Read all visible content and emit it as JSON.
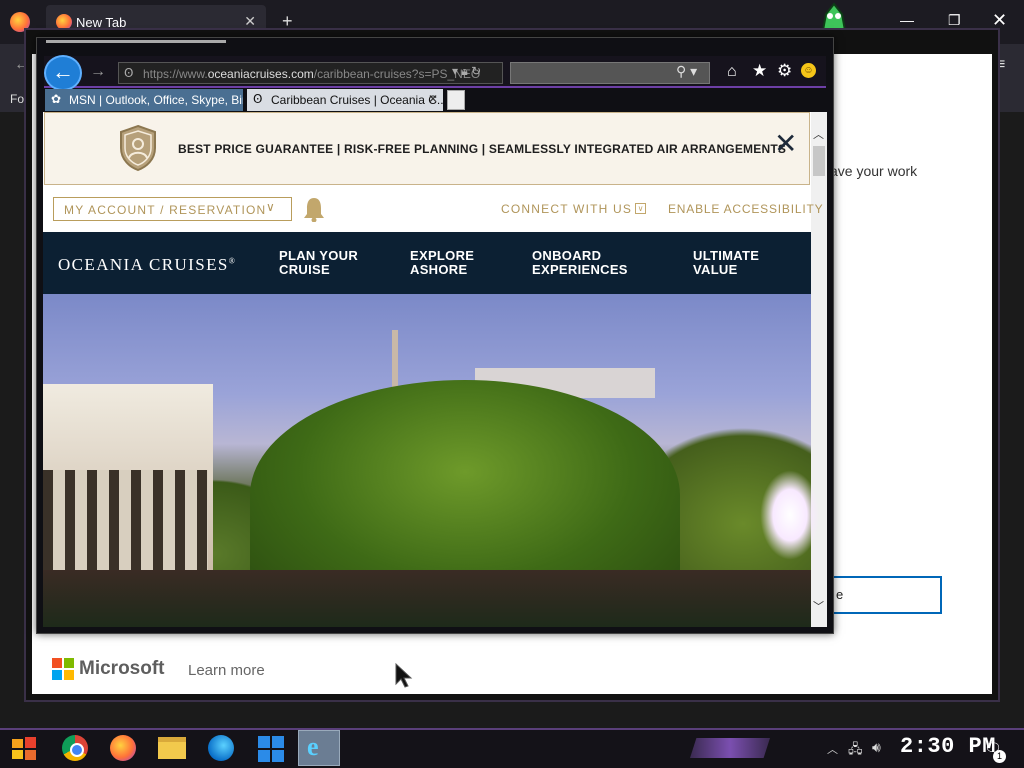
{
  "firefox": {
    "tab_title": "New Tab",
    "tab_close": "✕",
    "new_tab": "+",
    "toolbar_text": "Fo",
    "window_min": "—",
    "window_max": "❐",
    "window_close": "✕"
  },
  "dialog": {
    "partial_text": "ave your work",
    "button_partial": "e",
    "ms_brand": "Microsoft",
    "learn_more": "Learn more"
  },
  "ie": {
    "url_prefix": "https://www.",
    "url_domain": "oceaniacruises.com",
    "url_rest": "/caribbean-cruises?s=PS_NEO",
    "tabs": [
      {
        "label": "MSN | Outlook, Office, Skype, Bin...",
        "icon": "msn-icon"
      },
      {
        "label": "Caribbean Cruises | Oceania C...",
        "icon": "oceania-favicon"
      }
    ],
    "icons": [
      "back-icon",
      "forward-icon",
      "lock-icon",
      "refresh-icon",
      "search-icon",
      "home-icon",
      "favorites-star-icon",
      "gear-icon",
      "smiley-icon"
    ]
  },
  "site": {
    "promo": "BEST PRICE GUARANTEE | RISK-FREE PLANNING | SEAMLESSLY INTEGRATED AIR ARRANGEMENTS",
    "account": "MY ACCOUNT / RESERVATION",
    "connect": "CONNECT WITH US",
    "accessibility": "ENABLE ACCESSIBILITY",
    "logo": "OCEANIA CRUISES",
    "nav": [
      {
        "line1": "PLAN YOUR",
        "line2": "CRUISE"
      },
      {
        "line1": "EXPLORE",
        "line2": "ASHORE"
      },
      {
        "line1": "ONBOARD",
        "line2": "EXPERIENCES"
      },
      {
        "line1": "ULTIMATE",
        "line2": "VALUE"
      }
    ],
    "colors": {
      "navy": "#0c2033",
      "gold": "#b0955a",
      "cream": "#f8f3ea"
    }
  },
  "taskbar": {
    "clock": "2:30 PM",
    "notif_count": "1"
  }
}
